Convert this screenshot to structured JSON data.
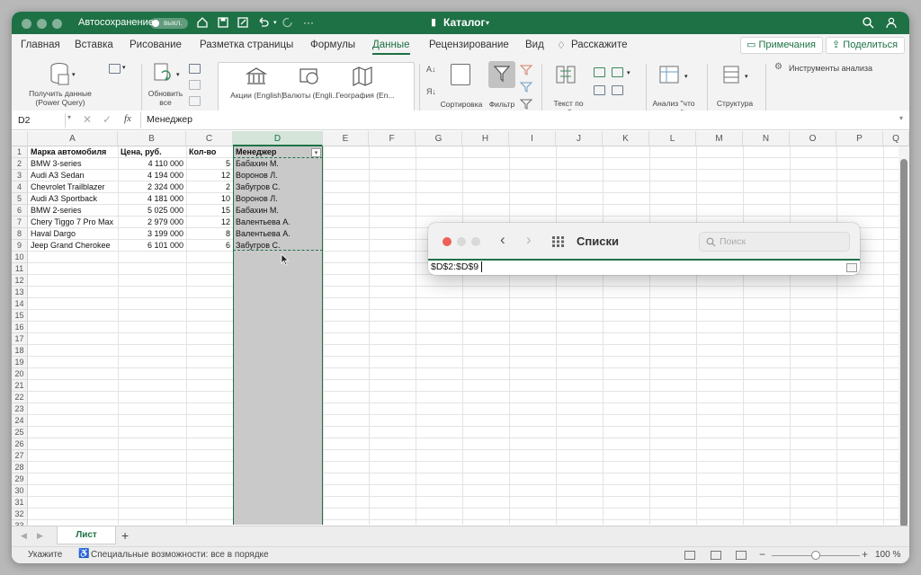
{
  "titlebar": {
    "autosave_label": "Автосохранение",
    "autosave_state": "выкл.",
    "doc_title": "Каталог",
    "more": "···"
  },
  "tabs": [
    {
      "label": "Главная"
    },
    {
      "label": "Вставка"
    },
    {
      "label": "Рисование"
    },
    {
      "label": "Разметка страницы"
    },
    {
      "label": "Формулы"
    },
    {
      "label": "Данные"
    },
    {
      "label": "Рецензирование"
    },
    {
      "label": "Вид"
    },
    {
      "label": "Расскажите"
    }
  ],
  "active_tab": "Данные",
  "ribbon_right": {
    "comments": "Примечания",
    "share": "Поделиться"
  },
  "ribbon": {
    "get_data": "Получить данные (Power Query)",
    "refresh_all": "Обновить все",
    "stocks": "Акции (English)",
    "currencies": "Валюты (Engli...",
    "geography": "География (En...",
    "sort": "Сортировка",
    "filter": "Фильтр",
    "text_to_columns": "Текст по столбцам",
    "what_if": "Анализ \"что если\"",
    "outline": "Структура",
    "analysis_tools": "Инструменты анализа"
  },
  "formula_bar": {
    "name_box": "D2",
    "fx": "fx",
    "value": "Менеджер"
  },
  "columns": [
    "A",
    "B",
    "C",
    "D",
    "E",
    "F",
    "G",
    "H",
    "I",
    "J",
    "K",
    "L",
    "M",
    "N",
    "O",
    "P",
    "Q"
  ],
  "selected_column": "D",
  "rows": [
    "1",
    "2",
    "3",
    "4",
    "5",
    "6",
    "7",
    "8",
    "9",
    "10",
    "11",
    "12",
    "13",
    "14",
    "15",
    "16",
    "17",
    "18",
    "19",
    "20",
    "21",
    "22",
    "23",
    "24",
    "25",
    "26",
    "27",
    "28",
    "29",
    "30",
    "31",
    "32",
    "33"
  ],
  "table": {
    "headers": [
      "Марка автомобиля",
      "Цена, руб.",
      "Кол-во",
      "Менеджер"
    ],
    "data": [
      [
        "BMW 3-series",
        "4 110 000",
        "5",
        "Бабахин М."
      ],
      [
        "Audi A3 Sedan",
        "4 194 000",
        "12",
        "Воронов Л."
      ],
      [
        "Chevrolet Trailblazer",
        "2 324 000",
        "2",
        "Забугров С."
      ],
      [
        "Audi A3 Sportback",
        "4 181 000",
        "10",
        "Воронов Л."
      ],
      [
        "BMW 2-series",
        "5 025 000",
        "15",
        "Бабахин М."
      ],
      [
        "Chery Tiggo 7 Pro Max",
        "2 979 000",
        "12",
        "Валентьева А."
      ],
      [
        "Haval Dargo",
        "3 199 000",
        "8",
        "Валентьева А."
      ],
      [
        "Jeep Grand Cherokee",
        "6 101 000",
        "6",
        "Забугров С."
      ]
    ]
  },
  "sheet_tabs": [
    {
      "label": "Лист"
    }
  ],
  "add_sheet": "+",
  "status": {
    "left": "Укажите",
    "accessibility": "Специальные возможности: все в порядке",
    "zoom": "100 %",
    "zoom_minus": "−",
    "zoom_plus": "+"
  },
  "dialog": {
    "title": "Списки",
    "search_placeholder": "Поиск",
    "range_value": "$D$2:$D$9"
  }
}
